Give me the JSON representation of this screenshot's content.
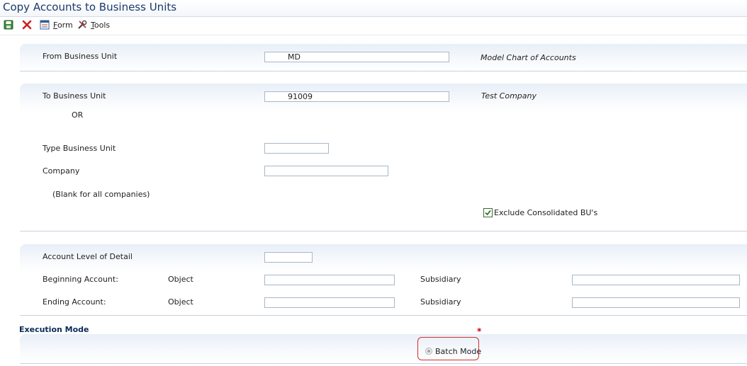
{
  "window": {
    "title": "Copy Accounts to Business Units"
  },
  "toolbar": {
    "save_icon": "save-icon",
    "cancel_icon": "close-icon",
    "form_label_prefix": "F",
    "form_label_rest": "orm",
    "tools_label_prefix": "T",
    "tools_label_rest": "ools"
  },
  "from_section": {
    "label": "From Business Unit",
    "value": "MD",
    "description": "Model Chart of Accounts"
  },
  "to_section": {
    "label": "To Business Unit",
    "value": "91009",
    "description": "Test Company",
    "or_label": "OR",
    "type_bu_label": "Type Business Unit",
    "type_bu_value": "",
    "company_label": "Company",
    "company_value": "",
    "blank_note": "(Blank for all companies)",
    "exclude_consolidated_label": "Exclude Consolidated BU's",
    "exclude_consolidated_checked": true
  },
  "account_section": {
    "level_label": "Account Level of Detail",
    "level_value": "",
    "beginning_label": "Beginning Account:",
    "ending_label": "Ending Account:",
    "object_label": "Object",
    "subsidiary_label": "Subsidiary",
    "beginning_object": "",
    "beginning_subsidiary": "",
    "ending_object": "",
    "ending_subsidiary": ""
  },
  "execution": {
    "title": "Execution Mode",
    "required_marker": "*",
    "batch_label": "Batch Mode",
    "batch_selected": true
  },
  "colors": {
    "title": "#1a3a6c",
    "section_title": "#0a2a57",
    "required": "#cc0000"
  }
}
